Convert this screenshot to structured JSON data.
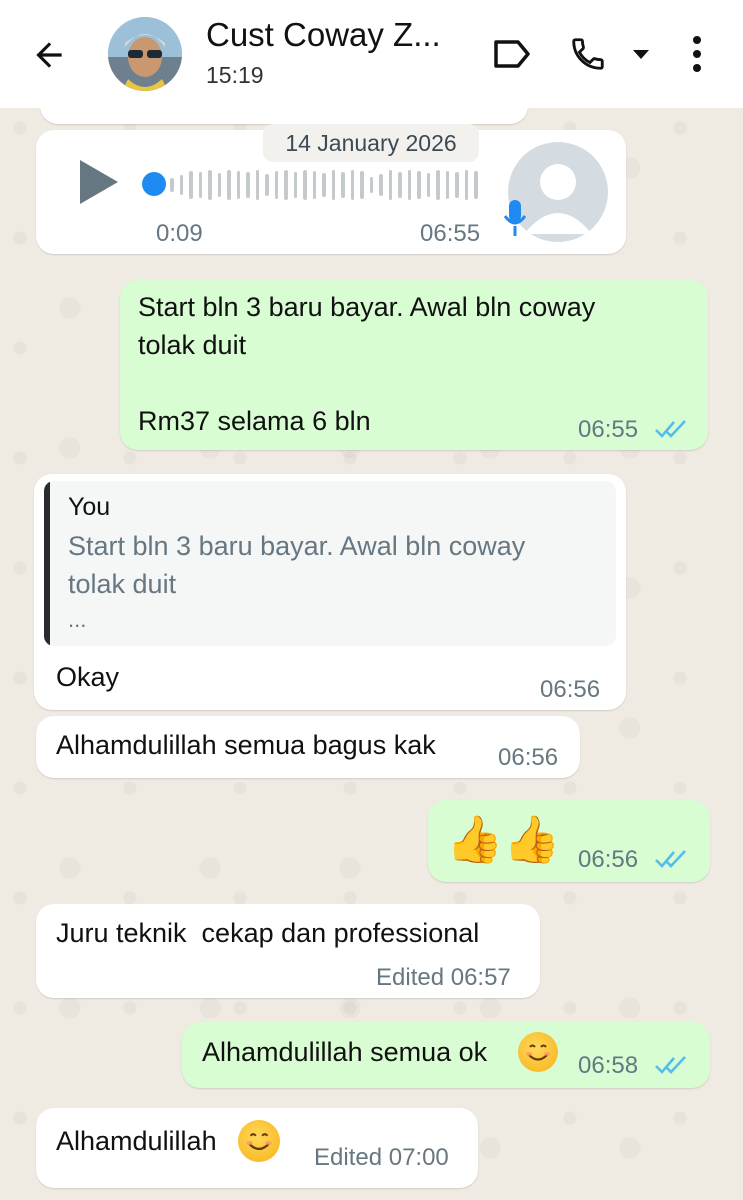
{
  "header": {
    "contact_name": "Cust Coway Z...",
    "subtitle": "15:19",
    "icons": [
      "back-arrow-icon",
      "label-icon",
      "phone-icon",
      "dropdown-icon",
      "more-vert-icon"
    ]
  },
  "date_chip": "14 January 2026",
  "voice_note": {
    "duration": "0:09",
    "time": "06:55"
  },
  "messages": [
    {
      "direction": "out",
      "text": "Start bln 3 baru bayar. Awal bln coway\ntolak duit\n\nRm37 selama 6 bln",
      "time": "06:55",
      "status": "read"
    },
    {
      "direction": "in",
      "quote_author": "You",
      "quote_text": "Start bln 3 baru bayar. Awal bln coway\ntolak duit",
      "quote_more": "...",
      "text": "Okay",
      "time": "06:56"
    },
    {
      "direction": "in",
      "text": "Alhamdulillah semua bagus kak",
      "time": "06:56"
    },
    {
      "direction": "out",
      "text": "👍👍",
      "time": "06:56",
      "status": "read"
    },
    {
      "direction": "in",
      "text": "Juru teknik  cekap dan professional",
      "time": "Edited 06:57"
    },
    {
      "direction": "out",
      "text": "Alhamdulillah semua ok",
      "time": "06:58",
      "status": "read"
    },
    {
      "direction": "in",
      "text": "Alhamdulillah",
      "time": "Edited 07:00"
    }
  ],
  "colors": {
    "outgoing": "#d9fdd3",
    "incoming": "#ffffff",
    "read_ticks": "#53bdeb",
    "voice_dot": "#1f8bf2"
  }
}
